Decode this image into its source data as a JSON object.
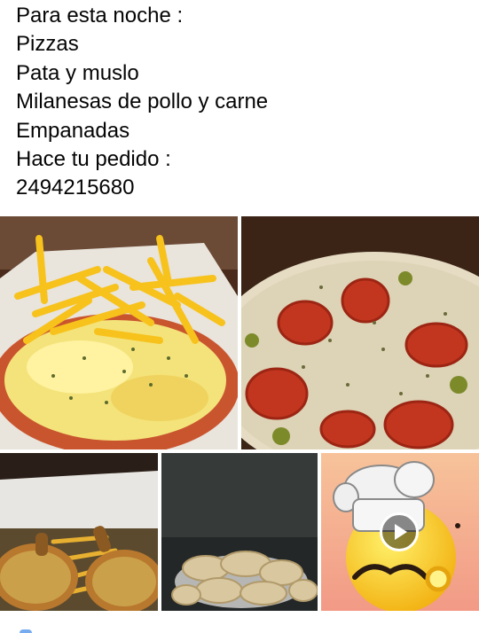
{
  "post": {
    "lines": [
      "Para esta noche :",
      "Pizzas",
      "Pata y muslo",
      "Milanesas de pollo y carne",
      "Empanadas",
      "Hace tu pedido :",
      "2494215680"
    ]
  },
  "media": {
    "items": [
      {
        "icon": "milanesa-fries-photo"
      },
      {
        "icon": "pizza-photo"
      },
      {
        "icon": "roast-chicken-photo"
      },
      {
        "icon": "empanadas-photo"
      },
      {
        "icon": "chef-emoji-video"
      }
    ],
    "play_icon": "play-icon"
  },
  "colors": {
    "text": "#050505",
    "background": "#ffffff"
  }
}
